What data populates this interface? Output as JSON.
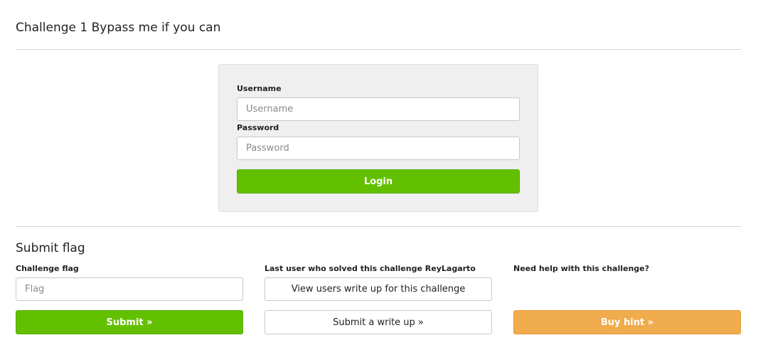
{
  "page": {
    "title": "Challenge 1 Bypass me if you can"
  },
  "login": {
    "username_label": "Username",
    "username_placeholder": "Username",
    "password_label": "Password",
    "password_placeholder": "Password",
    "login_label": "Login"
  },
  "flag": {
    "section_title": "Submit flag",
    "flag_label": "Challenge flag",
    "flag_placeholder": "Flag",
    "submit_label": "Submit »"
  },
  "writeup": {
    "last_solver_prefix": "Last user who solved this challenge",
    "last_solver_name": "ReyLagarto",
    "view_label": "View users write up for this challenge",
    "submit_label": "Submit a write up »"
  },
  "hint": {
    "help_label": "Need help with this challenge?",
    "buy_label": "Buy hint »"
  },
  "colors": {
    "primary_green": "#63c000",
    "hint_orange": "#f0ab4d",
    "panel_bg": "#efefef"
  }
}
